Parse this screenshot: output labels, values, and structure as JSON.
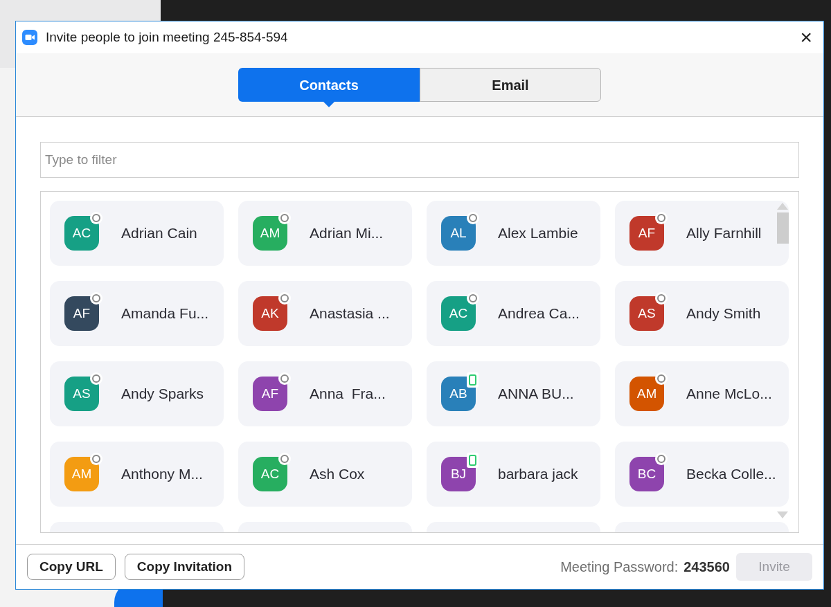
{
  "window": {
    "title": "Invite people to join meeting 245-854-594",
    "close": "×"
  },
  "tabs": [
    {
      "label": "Contacts",
      "selected": true
    },
    {
      "label": "Email",
      "selected": false
    }
  ],
  "filter": {
    "placeholder": "Type to filter"
  },
  "contacts": [
    {
      "initials": "AC",
      "name": "Adrian Cain",
      "color": "#16a085",
      "mobile": false
    },
    {
      "initials": "AM",
      "name": "Adrian Mi...",
      "color": "#27ae60",
      "mobile": false
    },
    {
      "initials": "AL",
      "name": "Alex Lambie",
      "color": "#2980b9",
      "mobile": false
    },
    {
      "initials": "AF",
      "name": "Ally Farnhill",
      "color": "#c0392b",
      "mobile": false
    },
    {
      "initials": "AF",
      "name": "Amanda Fu...",
      "color": "#34495e",
      "mobile": false
    },
    {
      "initials": "AK",
      "name": "Anastasia ...",
      "color": "#c0392b",
      "mobile": false
    },
    {
      "initials": "AC",
      "name": "Andrea Ca...",
      "color": "#16a085",
      "mobile": false
    },
    {
      "initials": "AS",
      "name": "Andy Smith",
      "color": "#c0392b",
      "mobile": false
    },
    {
      "initials": "AS",
      "name": "Andy Sparks",
      "color": "#16a085",
      "mobile": false
    },
    {
      "initials": "AF",
      "name": "Anna  Fra...",
      "color": "#8e44ad",
      "mobile": false
    },
    {
      "initials": "AB",
      "name": "ANNA BU...",
      "color": "#2980b9",
      "mobile": true
    },
    {
      "initials": "AM",
      "name": "Anne McLo...",
      "color": "#d35400",
      "mobile": false
    },
    {
      "initials": "AM",
      "name": "Anthony M...",
      "color": "#f39c12",
      "mobile": false
    },
    {
      "initials": "AC",
      "name": "Ash Cox",
      "color": "#27ae60",
      "mobile": false
    },
    {
      "initials": "BJ",
      "name": "barbara jack",
      "color": "#8e44ad",
      "mobile": true
    },
    {
      "initials": "BC",
      "name": "Becka Colle...",
      "color": "#8e44ad",
      "mobile": false
    }
  ],
  "footer": {
    "buttons": [
      "Copy URL",
      "Copy Invitation"
    ],
    "password_label": "Meeting Password:",
    "password": "243560",
    "invite": {
      "label": "Invite",
      "disabled": true
    }
  }
}
